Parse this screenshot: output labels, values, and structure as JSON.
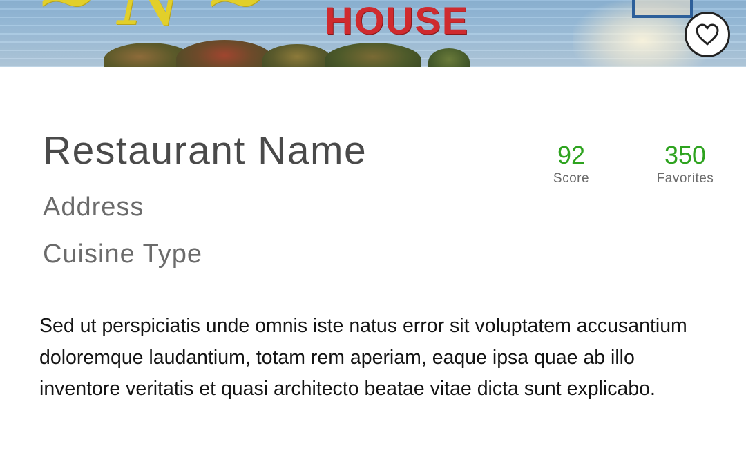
{
  "hero": {
    "sign_text": "HOUSE"
  },
  "favorite": {
    "icon": "heart-outline-icon"
  },
  "restaurant": {
    "name": "Restaurant Name",
    "address": "Address",
    "cuisine": "Cuisine Type",
    "description": "Sed ut perspiciatis unde omnis iste natus error sit voluptatem accusantium doloremque laudantium, totam rem aperiam, eaque ipsa quae ab illo inventore veritatis et quasi architecto beatae vitae dicta sunt explicabo."
  },
  "stats": {
    "score": {
      "value": "92",
      "label": "Score"
    },
    "favorites": {
      "value": "350",
      "label": "Favorites"
    }
  },
  "colors": {
    "accent_green": "#2ea31f",
    "heading_gray": "#4a4a4a",
    "subtext_gray": "#6b6b6b",
    "sign_red": "#cf2a2e",
    "sign_yellow": "#e2cf2a"
  }
}
